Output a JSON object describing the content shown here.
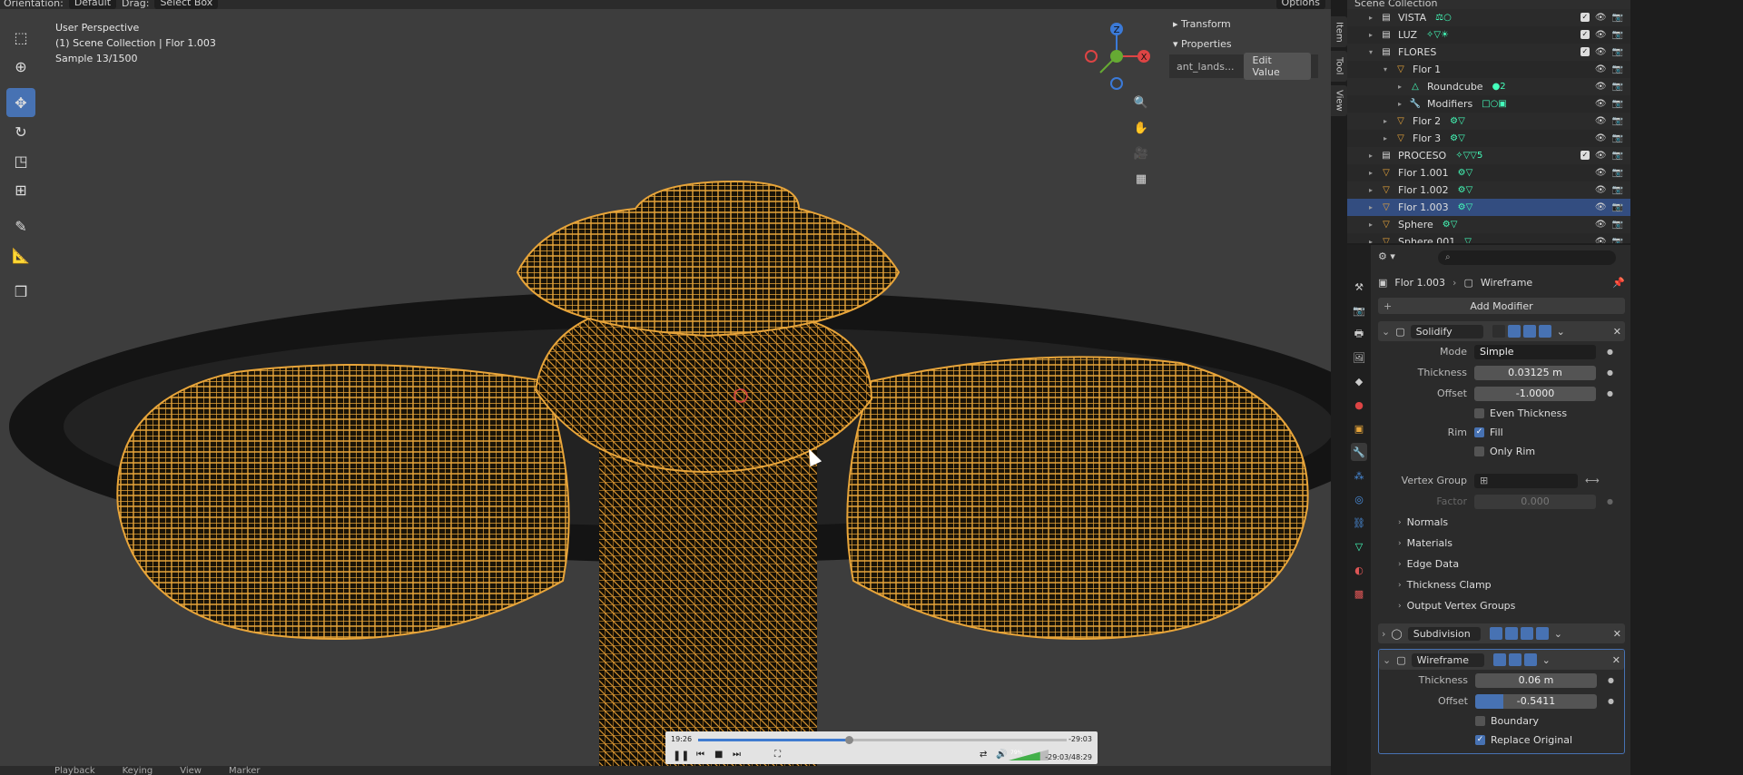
{
  "topbar": {
    "orientation_label": "Orientation:",
    "orientation_value": "Default",
    "drag_label": "Drag:",
    "drag_value": "Select Box",
    "options": "Options"
  },
  "viewport": {
    "perspective": "User Perspective",
    "collection": "(1) Scene Collection | Flor 1.003",
    "sample": "Sample 13/1500"
  },
  "npanel": {
    "transform": "Transform",
    "properties": "Properties",
    "prop_name": "ant_lands...",
    "edit_value": "Edit Value"
  },
  "vtabs": [
    "Item",
    "Tool",
    "View"
  ],
  "gizmo": {
    "z": "Z",
    "x": "X"
  },
  "player": {
    "elapsed": "19:26",
    "remaining": "-29:03",
    "time": "-29:03/48:29",
    "progress": 0.41,
    "volume": 0.79,
    "volume_label": "79%"
  },
  "outliner": {
    "header": "Scene Collection",
    "rows": [
      {
        "name": "VISTA",
        "icon": "collection-icon",
        "badges": "⚖○",
        "checked": true
      },
      {
        "name": "LUZ",
        "icon": "collection-icon",
        "badges": "✧▽☀",
        "checked": true
      },
      {
        "name": "FLORES",
        "icon": "collection-icon",
        "badges": "",
        "checked": true
      },
      {
        "name": "Flor 1",
        "icon": "object-icon",
        "badges": "",
        "checked": false
      },
      {
        "name": "Roundcube",
        "icon": "mesh-icon",
        "badges": "●2",
        "checked": false
      },
      {
        "name": "Modifiers",
        "icon": "wrench-icon",
        "badges": "□○▣",
        "checked": false
      },
      {
        "name": "Flor 2",
        "icon": "object-icon",
        "badges": "⚙▽",
        "checked": false
      },
      {
        "name": "Flor 3",
        "icon": "object-icon",
        "badges": "⚙▽",
        "checked": false
      },
      {
        "name": "PROCESO",
        "icon": "collection-icon",
        "badges": "✧▽▽5",
        "checked": true
      },
      {
        "name": "Flor 1.001",
        "icon": "object-icon",
        "badges": "⚙▽",
        "checked": false
      },
      {
        "name": "Flor 1.002",
        "icon": "object-icon",
        "badges": "⚙▽",
        "checked": false
      },
      {
        "name": "Flor 1.003",
        "icon": "object-icon",
        "badges": "⚙▽",
        "checked": false
      },
      {
        "name": "Sphere",
        "icon": "object-icon",
        "badges": "⚙▽",
        "checked": false
      },
      {
        "name": "Sphere.001",
        "icon": "object-icon",
        "badges": "▽",
        "checked": false
      }
    ]
  },
  "props": {
    "object": "Flor 1.003",
    "modifier": "Wireframe",
    "add_modifier": "Add Modifier",
    "solidify": {
      "name": "Solidify",
      "mode_label": "Mode",
      "mode_value": "Simple",
      "thickness_label": "Thickness",
      "thickness_value": "0.03125 m",
      "offset_label": "Offset",
      "offset_value": "-1.0000",
      "even_thickness": "Even Thickness",
      "rim_label": "Rim",
      "fill": "Fill",
      "only_rim": "Only Rim",
      "vgroup_label": "Vertex Group",
      "factor_label": "Factor",
      "factor_value": "0.000",
      "subpanels": [
        "Normals",
        "Materials",
        "Edge Data",
        "Thickness Clamp",
        "Output Vertex Groups"
      ]
    },
    "subdivision": {
      "name": "Subdivision"
    },
    "wireframe": {
      "name": "Wireframe",
      "thickness_label": "Thickness",
      "thickness_value": "0.06 m",
      "offset_label": "Offset",
      "offset_value": "-0.5411",
      "offset_fraction": 0.23,
      "boundary": "Boundary",
      "replace_original": "Replace Original"
    }
  },
  "bottombar": [
    "Playback",
    "Keying",
    "View",
    "Marker"
  ],
  "colors": {
    "accent": "#4772b3",
    "wire": "#e8a53a",
    "selected_row": "#334d80"
  }
}
